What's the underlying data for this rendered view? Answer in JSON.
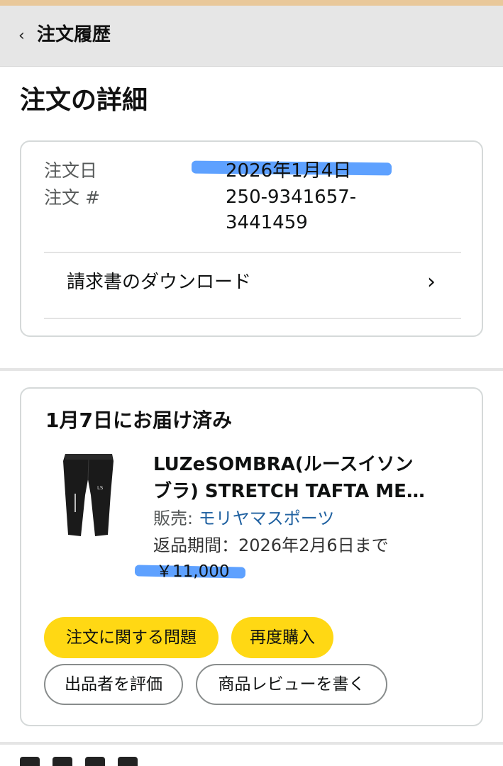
{
  "nav": {
    "back_icon": "chevron-left-icon",
    "title": "注文履歴"
  },
  "page": {
    "title": "注文の詳細"
  },
  "order_summary": {
    "date_label": "注文日",
    "date_value": "2026年1月4日",
    "number_label": "注文 #",
    "number_line1": "250-9341657-",
    "number_line2": "3441459",
    "invoice_label": "請求書のダウンロード",
    "invoice_icon": "chevron-right-icon"
  },
  "shipment": {
    "status": "1月7日にお届け済み",
    "product": {
      "name_line1": "LUZeSOMBRA(ルースイソン",
      "name_line2": "ブラ) STRETCH TAFTA ME…",
      "seller_label": "販売: ",
      "seller_name": "モリヤマスポーツ",
      "return_window": "返品期間：2026年2月6日まで",
      "price": "￥11,000"
    },
    "buttons": {
      "problem": "注文に関する問題",
      "buy_again": "再度購入",
      "rate_seller": "出品者を評価",
      "write_review": "商品レビューを書く"
    }
  },
  "colors": {
    "nav_bg": "#e6e6e6",
    "primary_button": "#ffd814",
    "link": "#2162a1",
    "highlight_marker": "#2882ff"
  }
}
